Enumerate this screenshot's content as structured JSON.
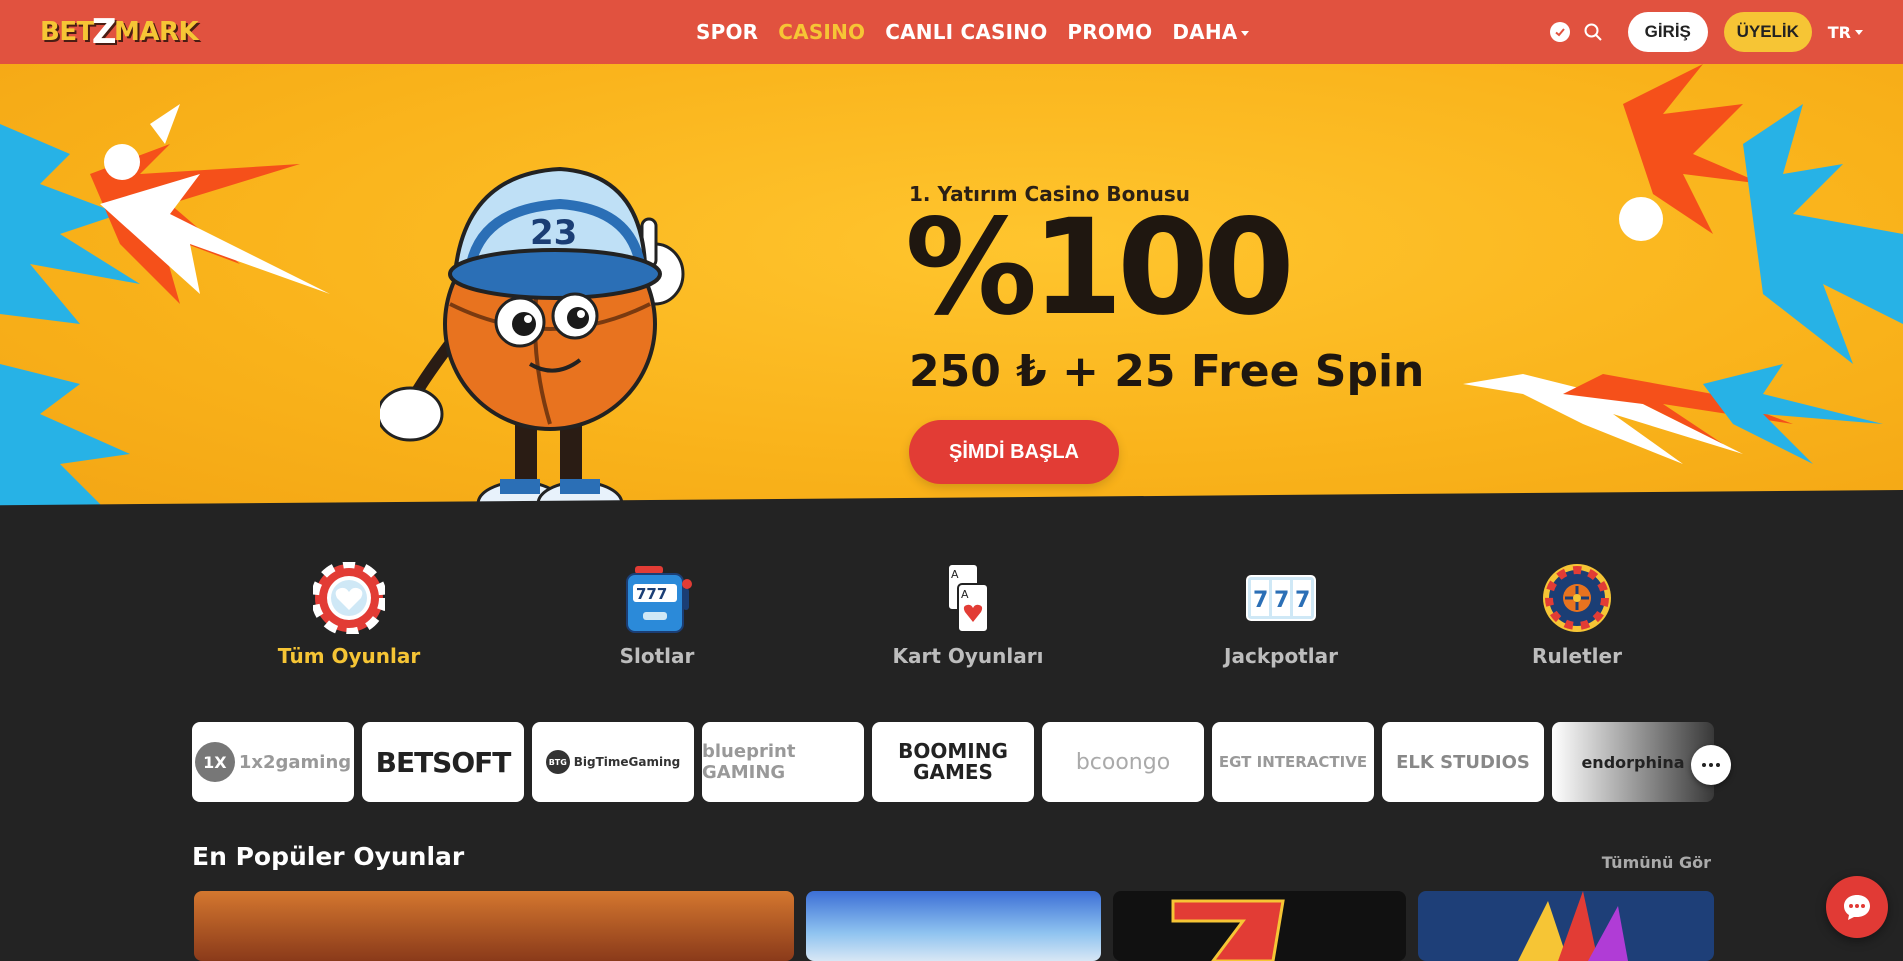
{
  "header": {
    "logo_text_left": "BET",
    "logo_bolt": "Z",
    "logo_text_right": "MARK",
    "nav": [
      {
        "label": "SPOR",
        "active": false
      },
      {
        "label": "CASINO",
        "active": true
      },
      {
        "label": "CANLI CASINO",
        "active": false
      },
      {
        "label": "PROMO",
        "active": false
      },
      {
        "label": "DAHA",
        "active": false
      }
    ],
    "login_label": "GİRİŞ",
    "signup_label": "ÜYELİK",
    "language": "TR",
    "icons": [
      "check-icon",
      "search-icon"
    ]
  },
  "hero": {
    "subtitle": "1. Yatırım Casino Bonusu",
    "headline": "%100",
    "offer": "250 ₺ + 25 Free Spin",
    "cta_label": "ŞİMDİ BAŞLA",
    "mascot_cap_number": "23",
    "slides": 3,
    "active_slide": 1
  },
  "categories": [
    {
      "label": "Tüm Oyunlar",
      "icon": "poker-chip-icon",
      "active": true
    },
    {
      "label": "Slotlar",
      "icon": "slot-machine-icon",
      "active": false
    },
    {
      "label": "Kart Oyunları",
      "icon": "playing-cards-icon",
      "active": false
    },
    {
      "label": "Jackpotlar",
      "icon": "jackpot-777-icon",
      "active": false
    },
    {
      "label": "Ruletler",
      "icon": "roulette-wheel-icon",
      "active": false
    }
  ],
  "providers": [
    {
      "name": "1x2gaming"
    },
    {
      "name": "BETSOFT"
    },
    {
      "name": "BigTimeGaming"
    },
    {
      "name": "blueprint GAMING"
    },
    {
      "name": "BOOMING GAMES"
    },
    {
      "name": "bcoongo"
    },
    {
      "name": "EGT INTERACTIVE"
    },
    {
      "name": "ELK STUDIOS"
    },
    {
      "name": "endorphina"
    }
  ],
  "popular": {
    "title": "En Popüler Oyunlar",
    "see_all": "Tümünü Gör"
  },
  "colors": {
    "header": "#e1523f",
    "accent_yellow": "#f6c535",
    "hero_bg": "#f9b21a",
    "page_bg": "#232323",
    "cta_red": "#e23c35"
  }
}
